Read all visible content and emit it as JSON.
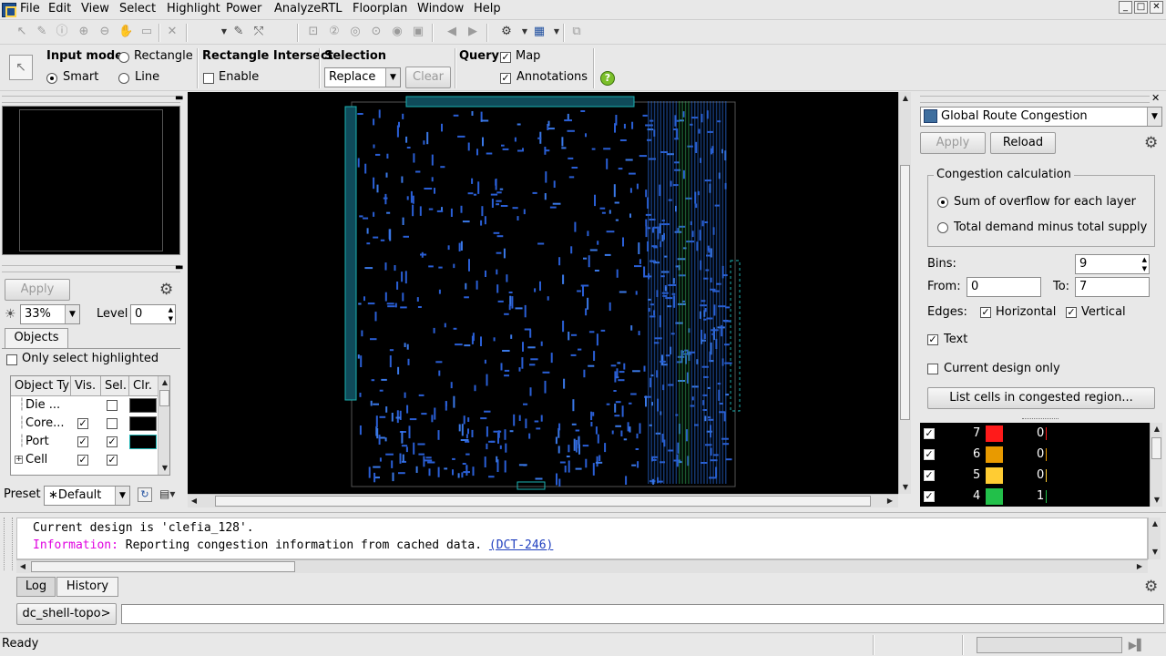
{
  "menu": [
    "File",
    "Edit",
    "View",
    "Select",
    "Highlight",
    "Power",
    "AnalyzeRTL",
    "Floorplan",
    "Window",
    "Help"
  ],
  "window_controls": {
    "minimize": "_",
    "maximize": "□",
    "close": "✕"
  },
  "options": {
    "input_mode_label": "Input mode",
    "rectangle": "Rectangle",
    "smart": "Smart",
    "line": "Line",
    "rect_intersect_label": "Rectangle Intersect",
    "enable": "Enable",
    "selection_label": "Selection",
    "selection_value": "Replace",
    "clear": "Clear",
    "query_label": "Query",
    "map": "Map",
    "annotations": "Annotations",
    "help": "?"
  },
  "left": {
    "apply": "Apply",
    "brightness": "33%",
    "level_label": "Level",
    "level_value": "0",
    "objects_tab": "Objects",
    "only_highlighted": "Only select highlighted",
    "headers": [
      "Object Ty",
      "Vis.",
      "Sel.",
      "Clr."
    ],
    "rows": [
      {
        "name": "Die ...",
        "vis": false,
        "sel": false,
        "color": "#000000"
      },
      {
        "name": "Core...",
        "vis": true,
        "sel": false,
        "color": "#000000"
      },
      {
        "name": "Port",
        "vis": true,
        "sel": true,
        "color": "#000000"
      },
      {
        "name": "Cell",
        "vis": true,
        "sel": true,
        "color": null
      }
    ],
    "preset_label": "Preset",
    "preset_value": "∗Default"
  },
  "right": {
    "map_select": "Global Route Congestion",
    "apply": "Apply",
    "reload": "Reload",
    "group_title": "Congestion calculation",
    "opt_sum": "Sum of overflow for each layer",
    "opt_total": "Total demand minus total supply",
    "bins_label": "Bins:",
    "bins_value": "9",
    "from_label": "From:",
    "from_value": "0",
    "to_label": "To:",
    "to_value": "7",
    "edges_label": "Edges:",
    "horizontal": "Horizontal",
    "vertical": "Vertical",
    "text": "Text",
    "current_only": "Current design only",
    "list_cells": "List cells in congested region...",
    "legend": [
      {
        "level": "7",
        "color": "#ff1a1a",
        "count": "0",
        "bar": "#ff1a1a"
      },
      {
        "level": "6",
        "color": "#e89a00",
        "count": "0",
        "bar": "#e89a00"
      },
      {
        "level": "5",
        "color": "#ffcc33",
        "count": "0",
        "bar": "#ffcc33"
      },
      {
        "level": "4",
        "color": "#22c04a",
        "count": "1",
        "bar": "#22c04a"
      }
    ]
  },
  "console": {
    "line1": "Current design is 'clefia_128'.",
    "info_label": "Information:",
    "info_text": " Reporting congestion information from cached data. ",
    "info_link": "(DCT-246)"
  },
  "tabs": {
    "log": "Log",
    "history": "History"
  },
  "prompt": "dc_shell-topo>",
  "status": "Ready"
}
